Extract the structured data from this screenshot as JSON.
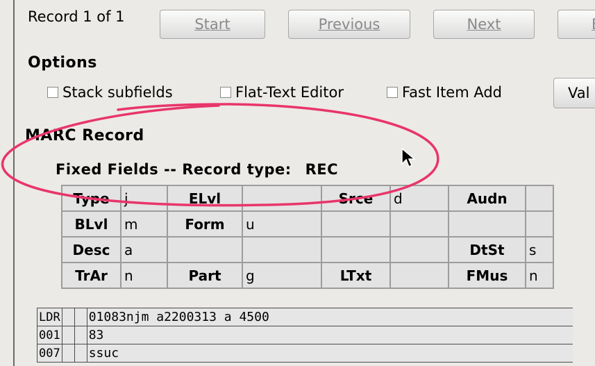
{
  "toolbar": {
    "record_count": "Record 1 of 1",
    "start_label": "Start",
    "previous_label": "Previous",
    "next_label": "Next",
    "end_label_partial": "E"
  },
  "options": {
    "title": "Options",
    "stack_subfields": "Stack subfields",
    "flat_text_editor": "Flat-Text Editor",
    "fast_item_add": "Fast Item Add",
    "validate_partial": "Val"
  },
  "marc": {
    "title": "MARC Record",
    "fixed_fields_label": "Fixed Fields -- Record type:",
    "record_type": "REC",
    "fixed_rows": [
      [
        "Type",
        "j",
        "ELvl",
        "",
        "Srce",
        "d",
        "Audn",
        ""
      ],
      [
        "BLvl",
        "m",
        "Form",
        "u",
        "",
        "",
        "",
        ""
      ],
      [
        "Desc",
        "a",
        "",
        "",
        "",
        "",
        "DtSt",
        "s"
      ],
      [
        "TrAr",
        "n",
        "Part",
        "g",
        "LTxt",
        "",
        "FMus",
        "n"
      ]
    ],
    "variable_rows": [
      [
        "LDR",
        "",
        "",
        "01083njm a2200313 a 4500"
      ],
      [
        "001",
        "",
        "",
        "83"
      ],
      [
        "007",
        "",
        "",
        "ssuc"
      ]
    ]
  },
  "colors": {
    "annotation_ring": "#e8356a",
    "grid_border": "#9c9c9c",
    "background": "#eceae6"
  },
  "icons": [
    "checkbox-icon",
    "mouse-pointer-icon"
  ]
}
